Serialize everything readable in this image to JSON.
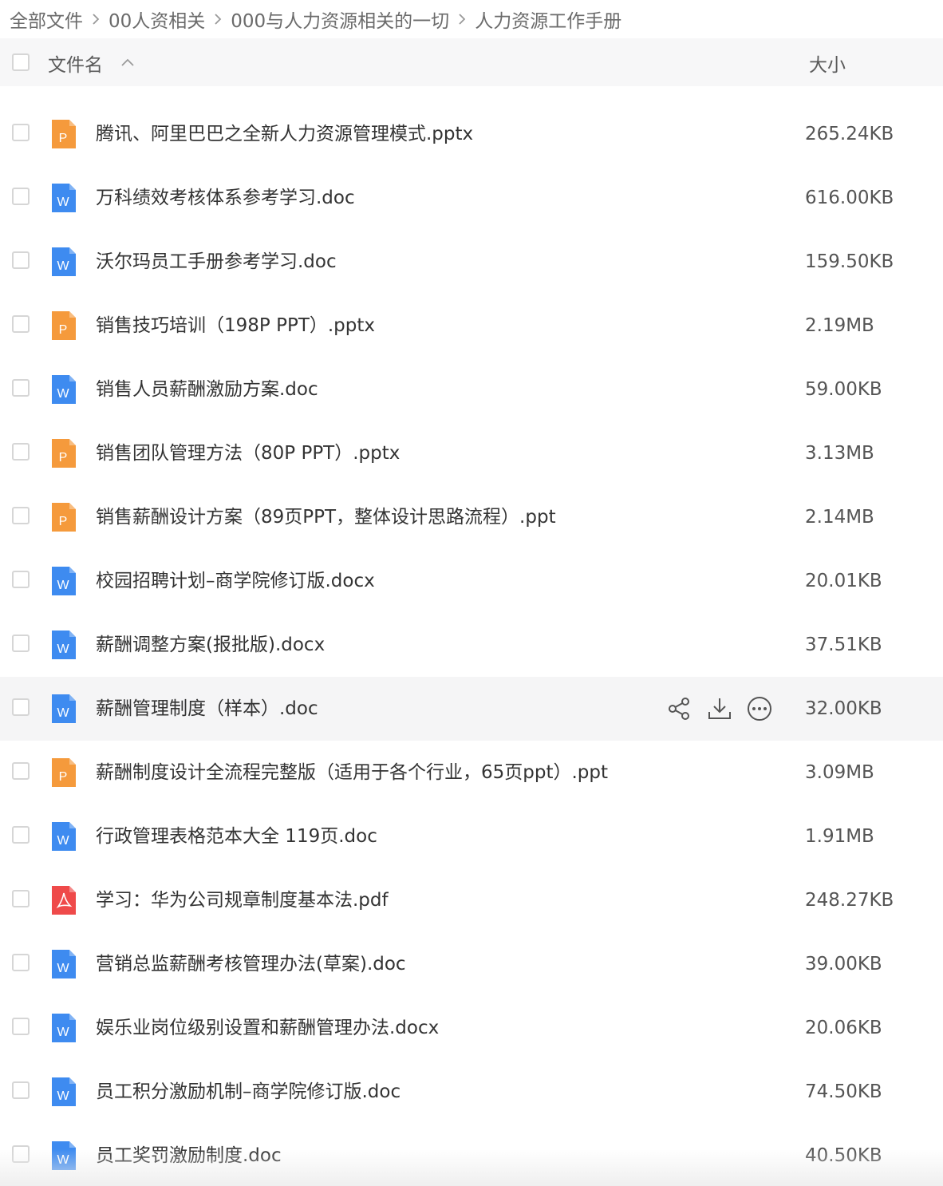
{
  "breadcrumb": {
    "items": [
      "全部文件",
      "00人资相关",
      "000与人力资源相关的一切",
      "人力资源工作手册"
    ]
  },
  "header": {
    "name_label": "文件名",
    "size_label": "大小"
  },
  "colors": {
    "pptx_icon": "#f59a3c",
    "doc_icon": "#3e8bf0",
    "pdf_icon": "#ef4a4a",
    "hover_row": "#f5f5f6"
  },
  "files": [
    {
      "name": "腾讯、阿里巴巴之全新人力资源管理模式.pptx",
      "size": "265.24KB",
      "type": "ppt",
      "icon": "ppt-icon"
    },
    {
      "name": "万科绩效考核体系参考学习.doc",
      "size": "616.00KB",
      "type": "word",
      "icon": "word-icon"
    },
    {
      "name": "沃尔玛员工手册参考学习.doc",
      "size": "159.50KB",
      "type": "word",
      "icon": "word-icon"
    },
    {
      "name": "销售技巧培训（198P PPT）.pptx",
      "size": "2.19MB",
      "type": "ppt",
      "icon": "ppt-icon"
    },
    {
      "name": "销售人员薪酬激励方案.doc",
      "size": "59.00KB",
      "type": "word",
      "icon": "word-icon"
    },
    {
      "name": "销售团队管理方法（80P PPT）.pptx",
      "size": "3.13MB",
      "type": "ppt",
      "icon": "ppt-icon"
    },
    {
      "name": "销售薪酬设计方案（89页PPT，整体设计思路流程）.ppt",
      "size": "2.14MB",
      "type": "ppt",
      "icon": "ppt-icon"
    },
    {
      "name": "校园招聘计划–商学院修订版.docx",
      "size": "20.01KB",
      "type": "word",
      "icon": "word-icon"
    },
    {
      "name": "薪酬调整方案(报批版).docx",
      "size": "37.51KB",
      "type": "word",
      "icon": "word-icon"
    },
    {
      "name": "薪酬管理制度（样本）.doc",
      "size": "32.00KB",
      "type": "word",
      "icon": "word-icon",
      "hover": true
    },
    {
      "name": "薪酬制度设计全流程完整版（适用于各个行业，65页ppt）.ppt",
      "size": "3.09MB",
      "type": "ppt",
      "icon": "ppt-icon"
    },
    {
      "name": "行政管理表格范本大全 119页.doc",
      "size": "1.91MB",
      "type": "word",
      "icon": "word-icon"
    },
    {
      "name": "学习：华为公司规章制度基本法.pdf",
      "size": "248.27KB",
      "type": "pdf",
      "icon": "pdf-icon"
    },
    {
      "name": "营销总监薪酬考核管理办法(草案).doc",
      "size": "39.00KB",
      "type": "word",
      "icon": "word-icon"
    },
    {
      "name": "娱乐业岗位级别设置和薪酬管理办法.docx",
      "size": "20.06KB",
      "type": "word",
      "icon": "word-icon"
    },
    {
      "name": "员工积分激励机制–商学院修订版.doc",
      "size": "74.50KB",
      "type": "word",
      "icon": "word-icon"
    },
    {
      "name": "员工奖罚激励制度.doc",
      "size": "40.50KB",
      "type": "word",
      "icon": "word-icon"
    }
  ],
  "row_actions": [
    "share-icon",
    "download-icon",
    "more-icon"
  ]
}
